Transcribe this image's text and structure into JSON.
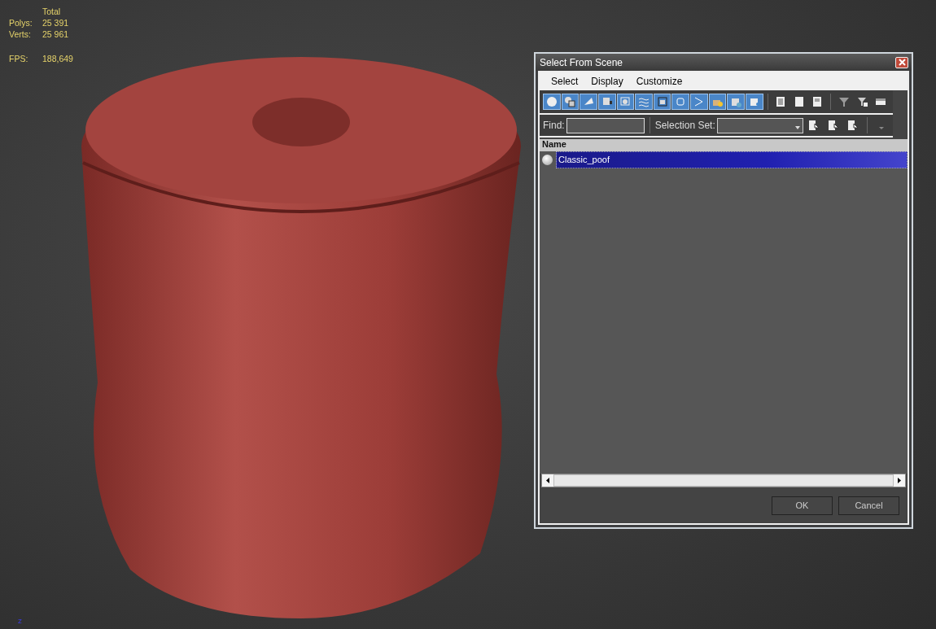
{
  "stats": {
    "header": "Total",
    "rows": [
      {
        "label": "Polys:",
        "value": "25 391"
      },
      {
        "label": "Verts:",
        "value": "25 961"
      }
    ],
    "fps": {
      "label": "FPS:",
      "value": "188,649"
    }
  },
  "axis_label": "z",
  "dialog": {
    "title": "Select From Scene",
    "menu": [
      "Select",
      "Display",
      "Customize"
    ],
    "filter_toggles": [
      {
        "on": true
      },
      {
        "on": true
      },
      {
        "on": true
      },
      {
        "on": true
      },
      {
        "on": true
      },
      {
        "on": true
      },
      {
        "on": true
      },
      {
        "on": true
      },
      {
        "on": true
      },
      {
        "on": true
      },
      {
        "on": true
      },
      {
        "on": true
      }
    ],
    "find": {
      "label": "Find:"
    },
    "selection_set": {
      "label": "Selection Set:"
    },
    "list": {
      "column": "Name",
      "rows": [
        {
          "name": "Classic_poof",
          "selected": true
        }
      ]
    },
    "buttons": [
      "OK",
      "Cancel"
    ]
  }
}
